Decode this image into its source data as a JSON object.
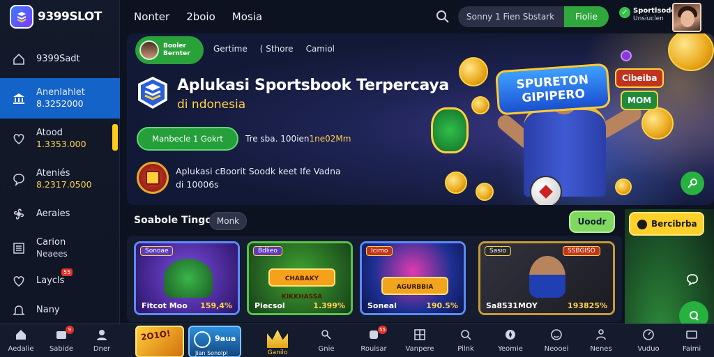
{
  "brand": {
    "name": "9399SLOT"
  },
  "header": {
    "nav": [
      "Nonter",
      "2boio",
      "Mosia"
    ],
    "search_placeholder": "Sonny 1 Fien Sbstark",
    "search_button": "Fiolie",
    "user_title": "Sportlsode",
    "user_sub": "Unsiuclen"
  },
  "sidebar": {
    "items": [
      {
        "label": "9399Sadt",
        "sub": "",
        "icon": "home-icon"
      },
      {
        "label": "Anenlahlet",
        "sub": "8.3252000",
        "icon": "bank-icon",
        "active": true
      },
      {
        "label": "Atood",
        "sub": "1.3353.000",
        "icon": "heart-icon"
      },
      {
        "label": "Ateniés",
        "sub": "8.2317.0500",
        "icon": "chat-icon"
      },
      {
        "label": "Aeraies",
        "sub": "",
        "icon": "fan-icon"
      },
      {
        "label": "Carion",
        "sub": "Neaees",
        "icon": "list-icon"
      },
      {
        "label": "Laycls",
        "sub": "",
        "icon": "heart-outline-icon",
        "badge": "55"
      },
      {
        "label": "Nany",
        "sub": "",
        "icon": "bell-icon"
      }
    ]
  },
  "hero": {
    "promo_pill": [
      "Booler",
      "Bernter"
    ],
    "tabs": [
      "Gertime",
      "( Sthore",
      "Camiol"
    ],
    "title": "Aplukasi Sportsbook Terpercaya",
    "subtitle": "di ndonesia",
    "cta": "Manbecle 1 Gokrt",
    "note_prefix": "Tre sba. 100ien",
    "note_highlight": "1ne02Mm",
    "desc_line1": "Aplukasi cBoorit Soodk keet Ife Vadna",
    "desc_line2": "di 10006s",
    "logo_l1": "SPURETON",
    "logo_l2": "GIPIPERO",
    "mini_card_1": "Cibeiba",
    "mini_card_2": "MOM"
  },
  "section": {
    "title": "Soabole Tingoa",
    "chip": "Monk",
    "button": "Uoodr"
  },
  "cards": [
    {
      "tag": "Sonoae",
      "title": "Fitcot Moo",
      "percent": "159,4%",
      "theme": "#4b2aa8"
    },
    {
      "tag": "Bdlieo",
      "title": "Piecsol",
      "percent": "1.399%",
      "theme": "#3d8a2e",
      "panel": "CHABAKY KIKKHASSA"
    },
    {
      "tag": "Icimo",
      "title": "Soneal",
      "percent": "190.5%",
      "theme": "#1d3fa6",
      "panel": "AGURBBIA"
    },
    {
      "tag": "Sasio",
      "title": "Sa8531MOY",
      "percent": "193825%",
      "theme": "#2a2a33",
      "tag2": "SSBGISO"
    }
  ],
  "promo_right": {
    "button": "Bercibrba"
  },
  "bottom_nav": [
    {
      "label": "Aedalie",
      "icon": "home-icon"
    },
    {
      "label": "Sabide",
      "icon": "ticket-icon",
      "badge": "9"
    },
    {
      "label": "Dner",
      "icon": "user-icon"
    },
    {
      "label": "Gnie",
      "icon": "feather-icon"
    },
    {
      "label": "Rouisar",
      "icon": "dice-icon",
      "badge": "55"
    },
    {
      "label": "Vanpere",
      "icon": "grid-icon"
    },
    {
      "label": "Pilnk",
      "icon": "search-doc-icon"
    },
    {
      "label": "Yeomie",
      "icon": "compass-icon"
    },
    {
      "label": "Neooei",
      "icon": "smile-icon"
    },
    {
      "label": "Nenes",
      "icon": "person-icon"
    },
    {
      "label": "Vuduo",
      "icon": "gauge-icon"
    },
    {
      "label": "Faimi",
      "icon": "tv-icon"
    }
  ],
  "bottom_cards": {
    "card1": "2O1O!",
    "card2_title": "9aua",
    "card2_sub": "Jian Sonolpl",
    "highlight_label": "Ganilo"
  },
  "colors": {
    "accent_green": "#2fa73c",
    "accent_blue": "#1463c9",
    "accent_yellow": "#ffd34d"
  }
}
